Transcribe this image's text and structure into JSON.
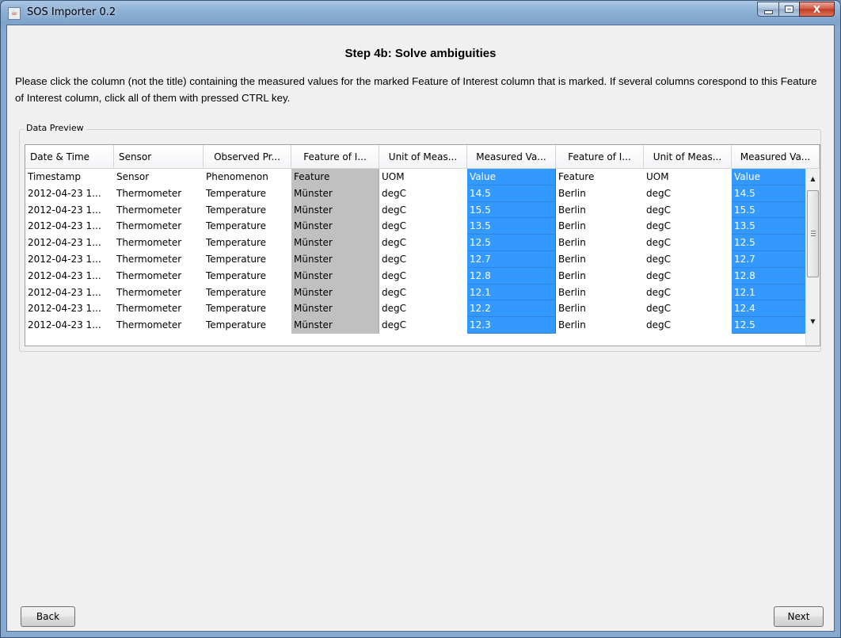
{
  "window": {
    "title": "SOS Importer 0.2",
    "icon": "java-cup-icon",
    "min_icon": "minimize-icon",
    "max_icon": "maximize-icon",
    "close_icon": "close-icon",
    "close_glyph": "X"
  },
  "step_title": "Step 4b: Solve ambiguities",
  "instructions": "Please click the column (not the title) containing the measured values for the marked Feature of Interest column that is marked. If several columns corespond to this Feature of Interest column, click all of them with pressed CTRL key.",
  "data_preview": {
    "label": "Data Preview",
    "columns": [
      "Date & Time",
      "Sensor",
      "Observed Pr...",
      "Feature of I...",
      "Unit of Meas...",
      "Measured Va...",
      "Feature of I...",
      "Unit of Meas...",
      "Measured Va..."
    ],
    "rows": [
      [
        "Timestamp",
        "Sensor",
        "Phenomenon",
        "Feature",
        "UOM",
        "Value",
        "Feature",
        "UOM",
        "Value"
      ],
      [
        "2012-04-23 1...",
        "Thermometer",
        "Temperature",
        "Münster",
        "degC",
        "14.5",
        "Berlin",
        "degC",
        "14.5"
      ],
      [
        "2012-04-23 1...",
        "Thermometer",
        "Temperature",
        "Münster",
        "degC",
        "15.5",
        "Berlin",
        "degC",
        "15.5"
      ],
      [
        "2012-04-23 1...",
        "Thermometer",
        "Temperature",
        "Münster",
        "degC",
        "13.5",
        "Berlin",
        "degC",
        "13.5"
      ],
      [
        "2012-04-23 1...",
        "Thermometer",
        "Temperature",
        "Münster",
        "degC",
        "12.5",
        "Berlin",
        "degC",
        "12.5"
      ],
      [
        "2012-04-23 1...",
        "Thermometer",
        "Temperature",
        "Münster",
        "degC",
        "12.7",
        "Berlin",
        "degC",
        "12.7"
      ],
      [
        "2012-04-23 1...",
        "Thermometer",
        "Temperature",
        "Münster",
        "degC",
        "12.8",
        "Berlin",
        "degC",
        "12.8"
      ],
      [
        "2012-04-23 1...",
        "Thermometer",
        "Temperature",
        "Münster",
        "degC",
        "12.1",
        "Berlin",
        "degC",
        "12.1"
      ],
      [
        "2012-04-23 1...",
        "Thermometer",
        "Temperature",
        "Münster",
        "degC",
        "12.2",
        "Berlin",
        "degC",
        "12.4"
      ],
      [
        "2012-04-23 1...",
        "Thermometer",
        "Temperature",
        "Münster",
        "degC",
        "12.3",
        "Berlin",
        "degC",
        "12.5"
      ]
    ],
    "marked_column": 3,
    "selected_columns": [
      5,
      8
    ],
    "colors": {
      "marked": "#c0c0c0",
      "selected": "#3399ff"
    },
    "scroll_up_icon": "scroll-up-arrow-icon",
    "scroll_down_icon": "scroll-down-arrow-icon"
  },
  "buttons": {
    "back": "Back",
    "next": "Next"
  }
}
